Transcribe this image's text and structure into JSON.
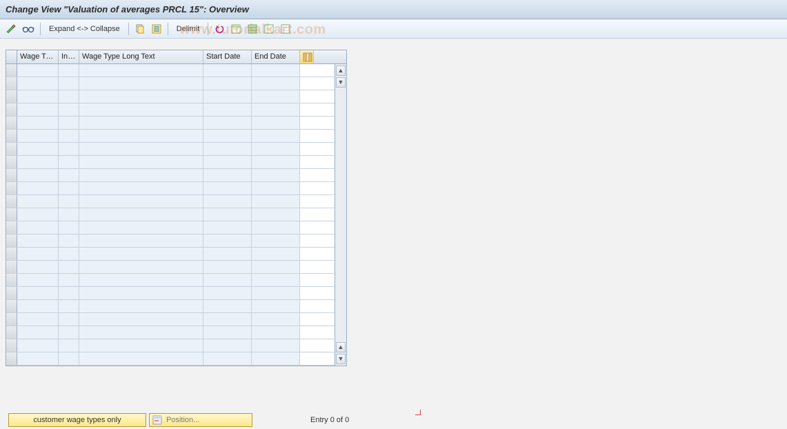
{
  "header": {
    "title": "Change View \"Valuation of averages PRCL 15\": Overview"
  },
  "toolbar": {
    "expand_label": "Expand <-> Collapse",
    "delimit_label": "Delimit"
  },
  "columns": {
    "wage_type": "Wage Ty...",
    "inf": "Inf...",
    "long_text": "Wage Type Long Text",
    "start_date": "Start Date",
    "end_date": "End Date"
  },
  "footer": {
    "customer_button": "customer wage types only",
    "position_button": "Position...",
    "entry_text": "Entry 0 of 0"
  },
  "watermark": "www.tutorialkart.com",
  "icons": {
    "toggle": "toggle-icon",
    "glasses": "glasses-icon",
    "copy": "copy-icon",
    "paste": "paste-icon",
    "undo": "undo-icon",
    "sel1": "select-all-icon",
    "sel2": "select-block-icon",
    "sel3": "deselect-all-icon",
    "sel4": "deselect-block-icon",
    "cfg": "configure-icon",
    "pos": "position-icon"
  }
}
